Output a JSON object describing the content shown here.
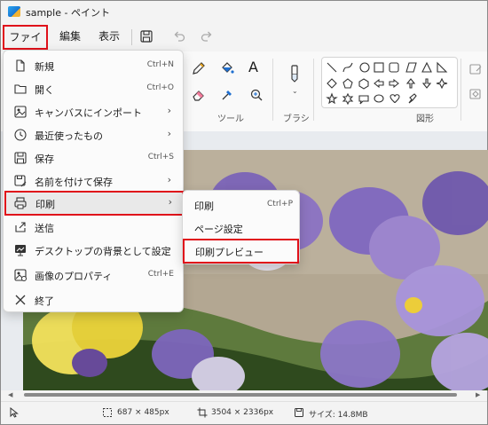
{
  "window": {
    "title": "sample - ペイント"
  },
  "menubar": {
    "file": "ファイル",
    "edit": "編集",
    "view": "表示"
  },
  "ribbon": {
    "tools_label": "ツール",
    "brush_label": "ブラシ",
    "shapes_label": "図形",
    "text_tool": "A"
  },
  "file_menu": {
    "items": [
      {
        "label": "新規",
        "shortcut": "Ctrl+N",
        "icon": "new-file-icon"
      },
      {
        "label": "開く",
        "shortcut": "Ctrl+O",
        "icon": "folder-icon"
      },
      {
        "label": "キャンバスにインポート",
        "shortcut": "",
        "icon": "import-icon",
        "arrow": "›"
      },
      {
        "label": "最近使ったもの",
        "shortcut": "",
        "icon": "clock-icon",
        "arrow": "›"
      },
      {
        "label": "保存",
        "shortcut": "Ctrl+S",
        "icon": "save-icon"
      },
      {
        "label": "名前を付けて保存",
        "shortcut": "",
        "icon": "save-as-icon",
        "arrow": "›"
      },
      {
        "label": "印刷",
        "shortcut": "",
        "icon": "printer-icon",
        "arrow": "›"
      },
      {
        "label": "送信",
        "shortcut": "",
        "icon": "share-icon"
      },
      {
        "label": "デスクトップの背景として設定",
        "shortcut": "",
        "icon": "desktop-icon",
        "arrow": "›"
      },
      {
        "label": "画像のプロパティ",
        "shortcut": "Ctrl+E",
        "icon": "properties-icon"
      },
      {
        "label": "終了",
        "shortcut": "",
        "icon": "close-icon"
      }
    ]
  },
  "print_menu": {
    "items": [
      {
        "label": "印刷",
        "shortcut": "Ctrl+P"
      },
      {
        "label": "ページ設定",
        "shortcut": ""
      },
      {
        "label": "印刷プレビュー",
        "shortcut": ""
      }
    ]
  },
  "statusbar": {
    "selection": "687 × 485px",
    "canvas_size": "3504 × 2336px",
    "file_size": "サイズ: 14.8MB"
  },
  "scrollbar": {
    "left_arrow": "◀",
    "right_arrow": "▶"
  },
  "colors": {
    "highlight_border": "#e0101a",
    "menu_bg": "#fbfbfb"
  }
}
